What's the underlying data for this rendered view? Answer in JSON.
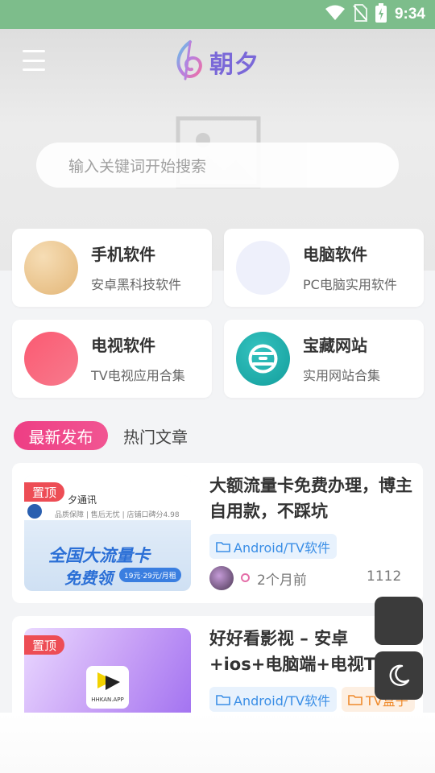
{
  "status_bar": {
    "time": "9:34"
  },
  "header": {
    "logo_text": "朝夕"
  },
  "search": {
    "placeholder": "输入关键词开始搜索"
  },
  "categories": [
    {
      "title": "手机软件",
      "subtitle": "安卓黑科技软件",
      "color": "#e9c28a"
    },
    {
      "title": "电脑软件",
      "subtitle": "PC电脑实用软件",
      "color": "#eef0fb"
    },
    {
      "title": "电视软件",
      "subtitle": "TV电视应用合集",
      "color": "#f5607a"
    },
    {
      "title": "宝藏网站",
      "subtitle": "实用网站合集",
      "color": "#1ba8a6"
    }
  ],
  "tabs": {
    "active": "最新发布",
    "other": "热门文章"
  },
  "posts": [
    {
      "pin": "置顶",
      "title": "大额流量卡免费办理，博主自用款，不踩坑",
      "tags": [
        "Android/TV软件"
      ],
      "time": "2个月前",
      "views": "1112",
      "thumb": {
        "brand": "夕通讯",
        "info": "品质保障 | 售后无忧 | 店铺口碑分4.98",
        "headline": "全国大流量卡",
        "headline2": "免费领",
        "badge": "19元·29元/月租"
      }
    },
    {
      "pin": "置顶",
      "title": "好好看影视 – 安卓+ios+电脑端+电视TV四",
      "tags": [
        "Android/TV软件",
        "TV盒子"
      ],
      "thumb": {
        "app_label": "HHKAN.APP"
      }
    }
  ]
}
